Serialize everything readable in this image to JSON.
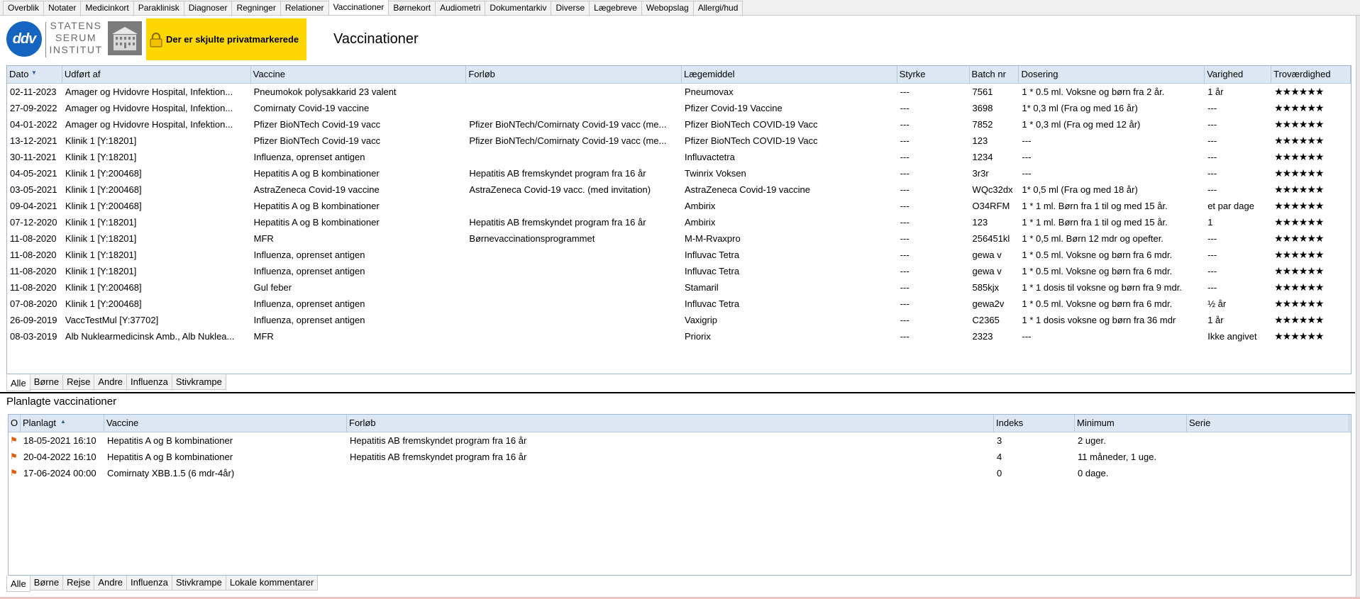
{
  "top_tabs": [
    "Overblik",
    "Notater",
    "Medicinkort",
    "Paraklinisk",
    "Diagnoser",
    "Regninger",
    "Relationer",
    "Vaccinationer",
    "Børnekort",
    "Audiometri",
    "Dokumentarkiv",
    "Diverse",
    "Lægebreve",
    "Webopslag",
    "Allergi/hud"
  ],
  "active_top_tab": "Vaccinationer",
  "logo": {
    "circle_text": "ddv",
    "ssi_text": "STATENS SERUM INSTITUT",
    "brand_color": "#1565c0"
  },
  "warning": {
    "text": "Der er skjulte privatmarkerede",
    "color": "#ffd700"
  },
  "page_title": "Vaccinationer",
  "vaccinations": {
    "columns": [
      "Dato",
      "Udført af",
      "Vaccine",
      "Forløb",
      "Lægemiddel",
      "Styrke",
      "Batch nr",
      "Dosering",
      "Varighed",
      "Troværdighed"
    ],
    "rows": [
      [
        "02-11-2023",
        "Amager og Hvidovre Hospital, Infektion...",
        "Pneumokok polysakkarid 23 valent",
        "",
        "Pneumovax",
        "---",
        "7561",
        "1 * 0.5 ml. Voksne og børn fra 2 år.",
        "1 år",
        "★★★★★★"
      ],
      [
        "27-09-2022",
        "Amager og Hvidovre Hospital, Infektion...",
        "Comirnaty Covid-19 vaccine",
        "",
        "Pfizer Covid-19 Vaccine",
        "---",
        "3698",
        "1* 0,3 ml (Fra og med 16 år)",
        "---",
        "★★★★★★"
      ],
      [
        "04-01-2022",
        "Amager og Hvidovre Hospital, Infektion...",
        "Pfizer BioNTech Covid-19 vacc",
        "Pfizer BioNTech/Comirnaty  Covid-19 vacc (me...",
        "Pfizer BioNTech COVID-19 Vacc",
        "---",
        "7852",
        "1 * 0,3 ml (Fra og med 12 år)",
        "---",
        "★★★★★★"
      ],
      [
        "13-12-2021",
        "Klinik 1  [Y:18201]",
        "Pfizer BioNTech Covid-19 vacc",
        "Pfizer BioNTech/Comirnaty  Covid-19 vacc (me...",
        "Pfizer BioNTech COVID-19 Vacc",
        "---",
        "123",
        "---",
        "---",
        "★★★★★★"
      ],
      [
        "30-11-2021",
        "Klinik 1  [Y:18201]",
        "Influenza, oprenset antigen",
        "",
        "Influvactetra",
        "---",
        "1234",
        "---",
        "---",
        "★★★★★★"
      ],
      [
        "04-05-2021",
        "Klinik 1  [Y:200468]",
        "Hepatitis A og B kombinationer",
        "Hepatitis AB fremskyndet program fra 16 år",
        "Twinrix Voksen",
        "---",
        "3r3r",
        "---",
        "---",
        "★★★★★★"
      ],
      [
        "03-05-2021",
        "Klinik 1  [Y:200468]",
        "AstraZeneca Covid-19 vaccine",
        "AstraZeneca Covid-19 vacc. (med invitation)",
        "AstraZeneca Covid-19 vaccine",
        "---",
        "WQc32dx",
        "1* 0,5 ml (Fra og med 18 år)",
        "---",
        "★★★★★★"
      ],
      [
        "09-04-2021",
        "Klinik 1  [Y:200468]",
        "Hepatitis A og B kombinationer",
        "",
        "Ambirix",
        "---",
        "O34RFM",
        "1 *  1 ml. Børn fra 1 til og med 15 år.",
        "et par dage",
        "★★★★★★"
      ],
      [
        "07-12-2020",
        "Klinik 1 [Y:18201]",
        "Hepatitis A og B kombinationer",
        "Hepatitis AB fremskyndet program fra 16 år",
        "Ambirix",
        "---",
        "123",
        "1 *  1 ml. Børn fra 1 til og med 15 år.",
        "1",
        "★★★★★★"
      ],
      [
        "11-08-2020",
        "Klinik 1 [Y:18201]",
        "MFR",
        "Børnevaccinationsprogrammet",
        "M-M-Rvaxpro",
        "---",
        "256451kl",
        "1 * 0,5 ml. Børn 12 mdr og opefter.",
        "---",
        "★★★★★★"
      ],
      [
        "11-08-2020",
        "Klinik 1 [Y:18201]",
        "Influenza, oprenset antigen",
        "",
        "Influvac Tetra",
        "---",
        "gewa v",
        "1 * 0.5 ml. Voksne og børn fra 6 mdr.",
        "---",
        "★★★★★★"
      ],
      [
        "11-08-2020",
        "Klinik 1 [Y:18201]",
        "Influenza, oprenset antigen",
        "",
        "Influvac Tetra",
        "---",
        "gewa v",
        "1 * 0.5 ml. Voksne og børn fra 6 mdr.",
        "---",
        "★★★★★★"
      ],
      [
        "11-08-2020",
        "Klinik 1  [Y:200468]",
        "Gul feber",
        "",
        "Stamaril",
        "---",
        "585kjx",
        "1 * 1 dosis til voksne og børn fra 9 mdr.",
        "---",
        "★★★★★★"
      ],
      [
        "07-08-2020",
        "Klinik 1  [Y:200468]",
        "Influenza, oprenset antigen",
        "",
        "Influvac Tetra",
        "---",
        "gewa2v",
        "1 * 0.5 ml. Voksne og børn fra 6 mdr.",
        "½ år",
        "★★★★★★"
      ],
      [
        "26-09-2019",
        "VaccTestMul [Y:37702]",
        "Influenza, oprenset antigen",
        "",
        "Vaxigrip",
        "---",
        "C2365",
        "1 * 1 dosis voksne og børn fra 36 mdr",
        "1 år",
        "★★★★★★"
      ],
      [
        "08-03-2019",
        "Alb Nuklearmedicinsk Amb., Alb Nuklea...",
        "MFR",
        "",
        "Priorix",
        "---",
        "2323",
        "---",
        "Ikke angivet",
        "★★★★★★"
      ]
    ]
  },
  "filter_tabs_top": [
    "Alle",
    "Børne",
    "Rejse",
    "Andre",
    "Influenza",
    "Stivkrampe"
  ],
  "planned_title": "Planlagte vaccinationer",
  "planned": {
    "columns": [
      "O",
      "Planlagt",
      "Vaccine",
      "Forløb",
      "Indeks",
      "Minimum",
      "Serie"
    ],
    "rows": [
      [
        "18-05-2021 16:10",
        "Hepatitis A og B kombinationer",
        "Hepatitis AB fremskyndet program fra 16 år",
        "3",
        "2 uger.",
        ""
      ],
      [
        "20-04-2022 16:10",
        "Hepatitis A og B kombinationer",
        "Hepatitis AB fremskyndet program fra 16 år",
        "4",
        "11 måneder, 1 uge.",
        ""
      ],
      [
        "17-06-2024 00:00",
        "Comirnaty XBB.1.5 (6 mdr-4år)",
        "",
        "0",
        "0 dage.",
        ""
      ]
    ]
  },
  "filter_tabs_bottom": [
    "Alle",
    "Børne",
    "Rejse",
    "Andre",
    "Influenza",
    "Stivkrampe",
    "Lokale kommentarer"
  ]
}
